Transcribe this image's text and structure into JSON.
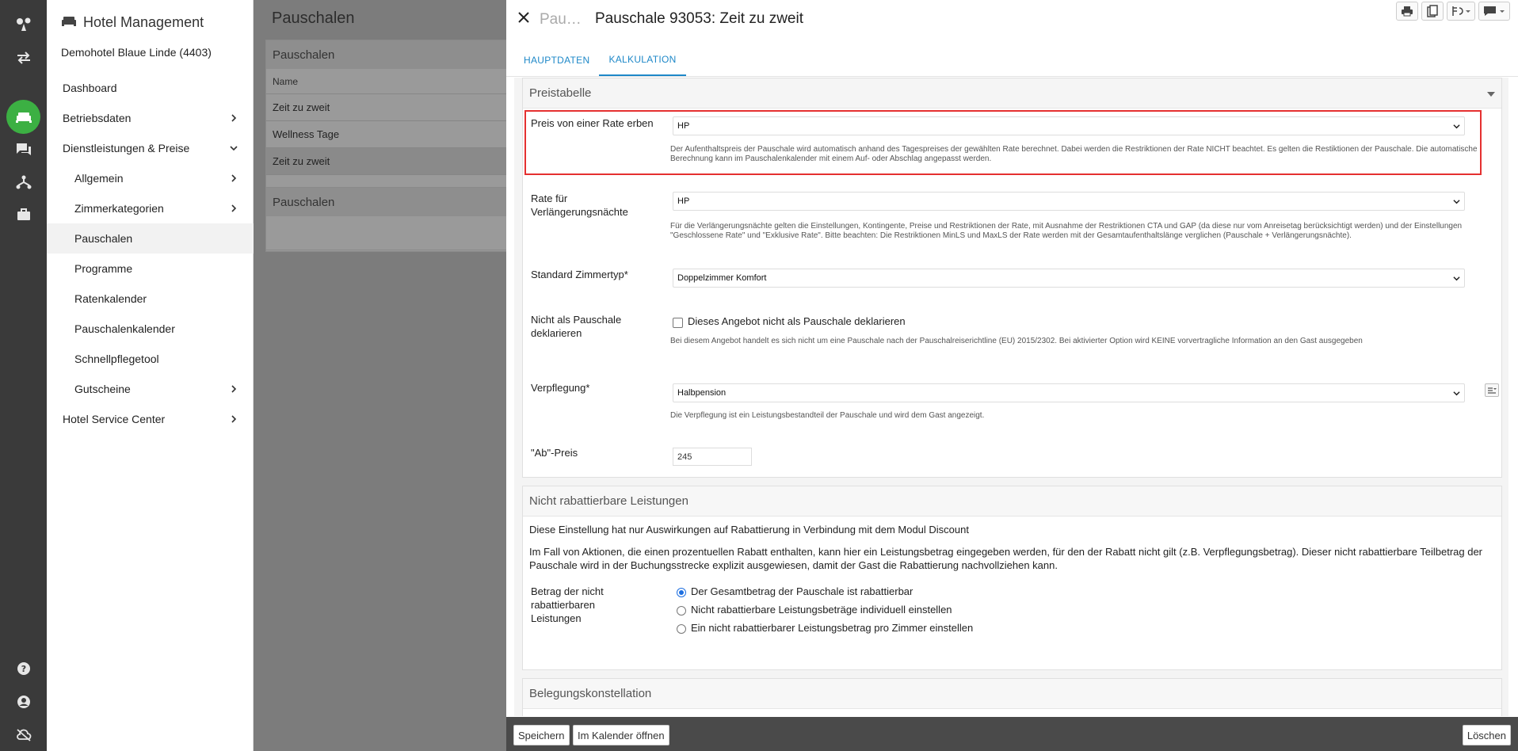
{
  "rail": {
    "icons": [
      "logo-icon",
      "switch-icon",
      "hotel-icon",
      "chat-icon",
      "sitemap-icon",
      "briefcase-icon",
      "help-icon",
      "user-icon",
      "cloud-off-icon"
    ]
  },
  "sidebar": {
    "title": "Hotel Management",
    "hotel": "Demohotel Blaue Linde (4403)",
    "items": [
      {
        "label": "Dashboard"
      },
      {
        "label": "Betriebsdaten"
      },
      {
        "label": "Dienstleistungen & Preise"
      },
      {
        "label": "Allgemein"
      },
      {
        "label": "Zimmerkategorien"
      },
      {
        "label": "Pauschalen"
      },
      {
        "label": "Programme"
      },
      {
        "label": "Ratenkalender"
      },
      {
        "label": "Pauschalenkalender"
      },
      {
        "label": "Schnellpflegetool"
      },
      {
        "label": "Gutscheine"
      },
      {
        "label": "Hotel Service Center"
      }
    ]
  },
  "background": {
    "title": "Pauschalen",
    "card1_header": "Pauschalen",
    "column_name": "Name",
    "rows": [
      "Zeit zu zweit",
      "Wellness Tage",
      "Zeit zu zweit"
    ],
    "card2_header": "Pauschalen"
  },
  "modal": {
    "crumb": "Pau…",
    "title": "Pauschale 93053: Zeit zu zweit",
    "tabs": [
      "HAUPTDATEN",
      "KALKULATION"
    ],
    "preistabelle": {
      "header": "Preistabelle",
      "inherit_label": "Preis von einer Rate erben",
      "inherit_value": "HP",
      "inherit_help": "Der Aufenthaltspreis der Pauschale wird automatisch anhand des Tagespreises der gewählten Rate berechnet. Dabei werden die Restriktionen der Rate NICHT beachtet. Es gelten die Restiktionen der Pauschale. Die automatische Berechnung kann im Pauschalenkalender mit einem Auf- oder Abschlag angepasst werden.",
      "extension_label": "Rate für Verlängerungsnächte",
      "extension_value": "HP",
      "extension_help": "Für die Verlängerungsnächte gelten die Einstellungen, Kontingente, Preise und Restriktionen der Rate, mit Ausnahme der Restriktionen CTA und GAP (da diese nur vom Anreisetag berücksichtigt werden) und der Einstellungen \"Geschlossene Rate\" und \"Exklusive Rate\". Bitte beachten: Die Restriktionen MinLS und MaxLS der Rate werden mit der Gesamtaufenthaltslänge verglichen (Pauschale + Verlängerungsnächte).",
      "roomtype_label": "Standard Zimmertyp*",
      "roomtype_value": "Doppelzimmer Komfort",
      "declare_label": "Nicht als Pauschale deklarieren",
      "declare_checkbox": "Dieses Angebot nicht als Pauschale deklarieren",
      "declare_help": "Bei diesem Angebot handelt es sich nicht um eine Pauschale nach der Pauschalreiserichtline (EU) 2015/2302. Bei aktivierter Option wird KEINE vorvertragliche Information an den Gast ausgegeben",
      "meal_label": "Verpflegung*",
      "meal_value": "Halbpension",
      "meal_help": "Die Verpflegung ist ein Leistungsbestandteil der Pauschale und wird dem Gast angezeigt.",
      "price_label": "\"Ab\"-Preis",
      "price_value": "245"
    },
    "discount": {
      "header": "Nicht rabattierbare Leistungen",
      "text1": "Diese Einstellung hat nur Auswirkungen auf Rabattierung in Verbindung mit dem Modul Discount",
      "text2": "Im Fall von Aktionen, die einen prozentuellen Rabatt enthalten, kann hier ein Leistungsbetrag eingegeben werden, für den der Rabatt nicht gilt (z.B. Verpflegungsbetrag). Dieser nicht rabattierbare Teilbetrag der Pauschale wird in der Buchungsstrecke explizit ausgewiesen, damit der Gast die Rabattierung nachvollziehen kann.",
      "amount_label": "Betrag der nicht rabattierbaren Leistungen",
      "options": [
        "Der Gesamtbetrag der Pauschale ist rabattierbar",
        "Nicht rabattierbare Leistungsbeträge individuell einstellen",
        "Ein nicht rabattierbarer Leistungsbetrag pro Zimmer einstellen"
      ],
      "selected_option": 0
    },
    "occupancy": {
      "header": "Belegungskonstellation"
    },
    "footer": {
      "save": "Speichern",
      "open_calendar": "Im Kalender öffnen",
      "delete": "Löschen"
    }
  },
  "colors": {
    "accent": "#1e88c8",
    "rail_active": "#3cb043",
    "highlight": "#e53030"
  }
}
